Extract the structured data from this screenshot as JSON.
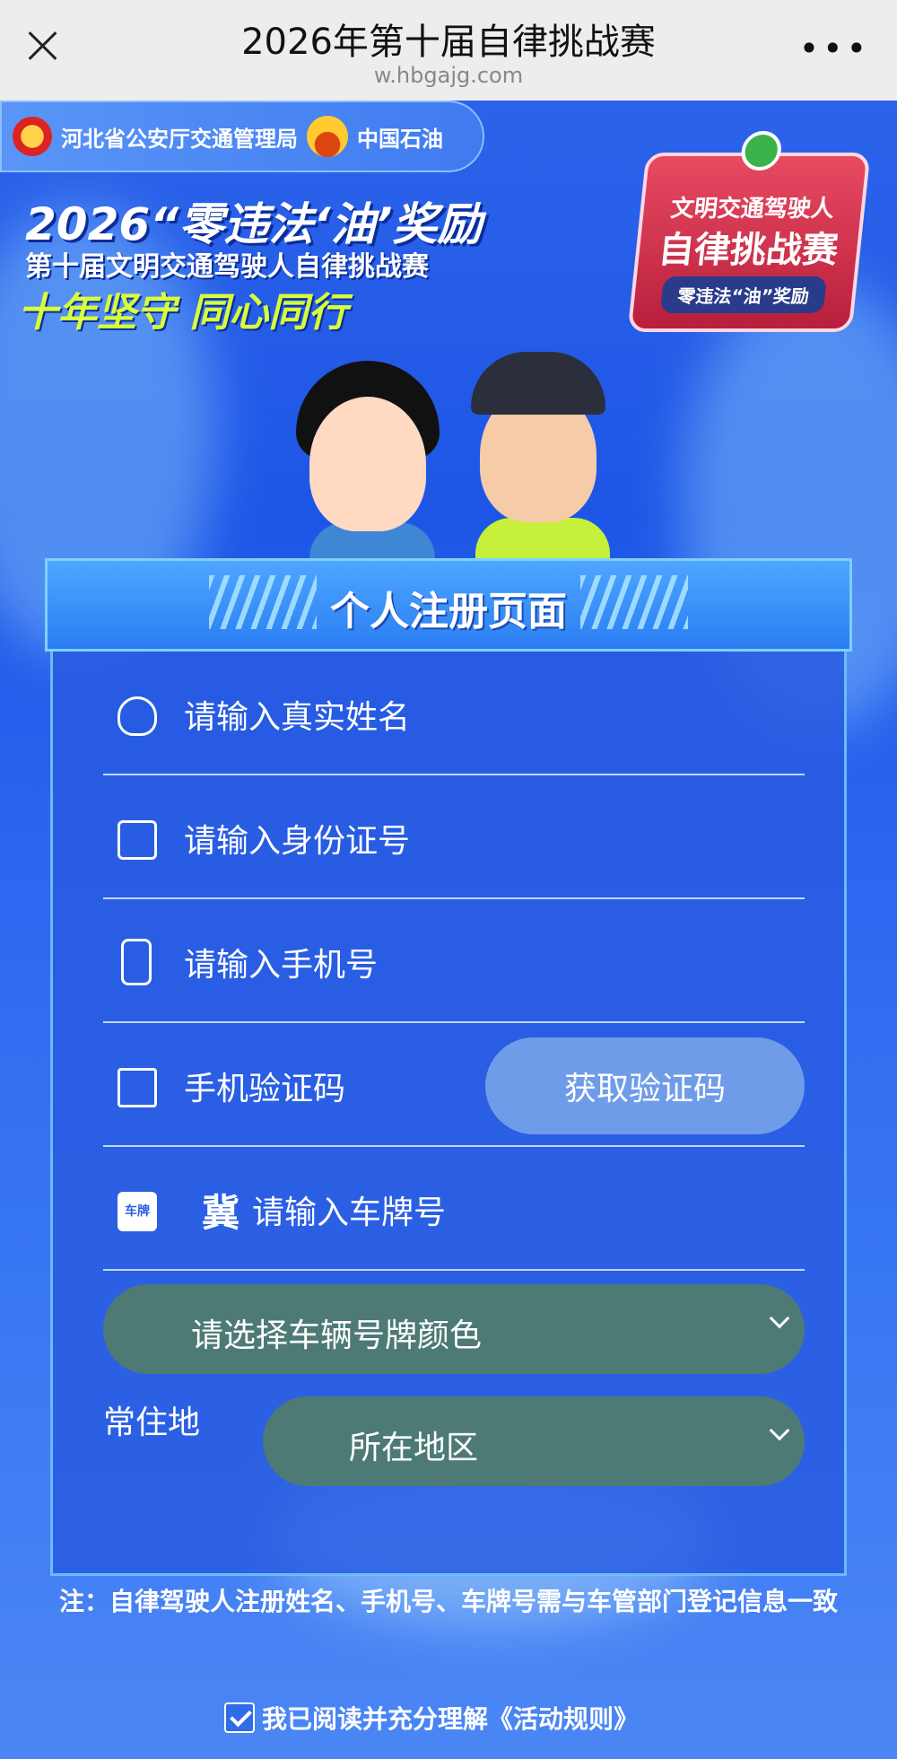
{
  "browser": {
    "title": "2026年第十届自律挑战赛",
    "url": "w.hbgajg.com",
    "more": "•••"
  },
  "header": {
    "org1": "河北省公安厅交通管理局",
    "org2": "中国石油",
    "banner_line1": "2026“零违法‘油’奖励",
    "banner_line2": "第十届文明交通驾驶人自律挑战赛",
    "banner_line3": "十年坚守 同心同行",
    "badge_line1": "文明交通驾驶人",
    "badge_line2": "自律挑战赛",
    "badge_line3": "零违法“油”奖励"
  },
  "form": {
    "title": "个人注册页面",
    "name_placeholder": "请输入真实姓名",
    "id_placeholder": "请输入身份证号",
    "phone_placeholder": "请输入手机号",
    "code_placeholder": "手机验证码",
    "get_code_label": "获取验证码",
    "plate_icon_text": "车牌",
    "plate_province": "冀",
    "plate_placeholder": "请输入车牌号",
    "plate_color_select": "请选择车辆号牌颜色",
    "residence_label": "常住地",
    "region_select": "所在地区"
  },
  "note": "注：自律驾驶人注册姓名、手机号、车牌号需与车管部门登记信息一致",
  "agreement": {
    "label": "我已阅读并充分理解《活动规则》",
    "checked": true
  }
}
